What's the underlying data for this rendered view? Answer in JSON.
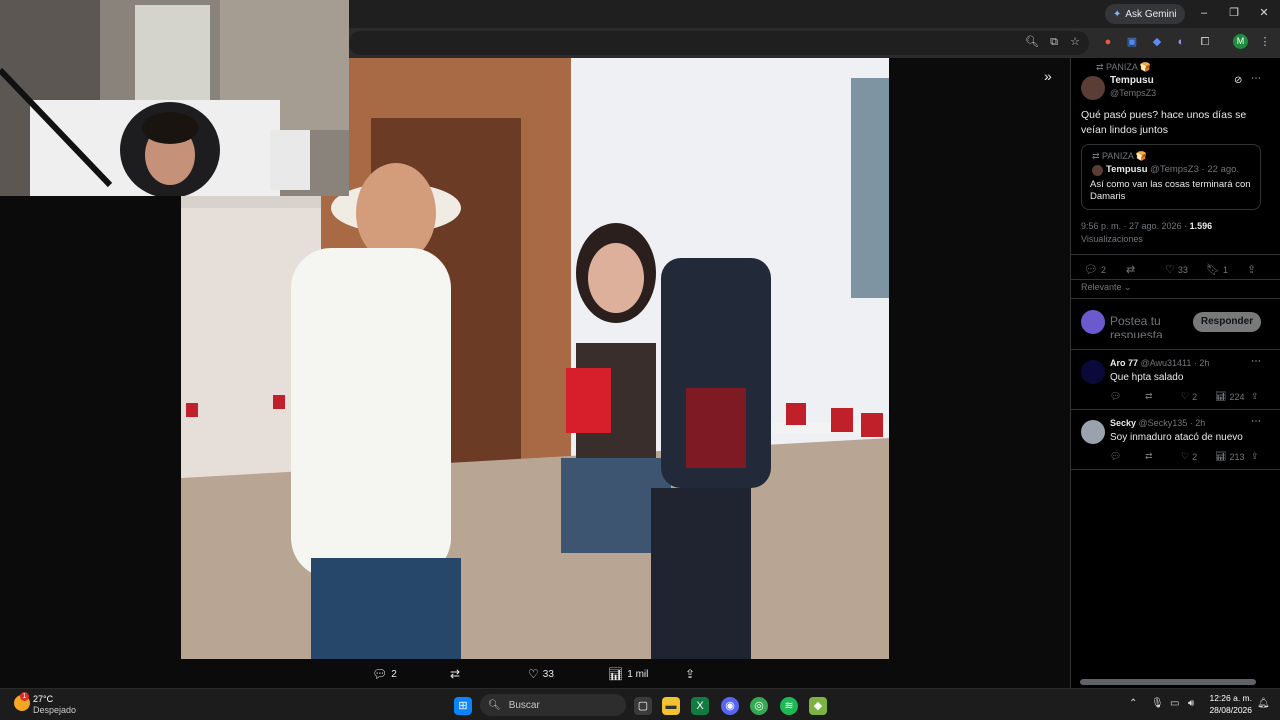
{
  "browser": {
    "gemini_label": "Ask Gemini",
    "profile_initial": "M"
  },
  "viewer": {
    "actions": {
      "replies": "2",
      "likes": "33",
      "views": "1 mil"
    }
  },
  "panel": {
    "repost_label": "PANIZA 🍞",
    "author_name": "Tempusu",
    "author_handle": "@TempsZ3",
    "post_text": "Qué pasó pues? hace unos días se veían lindos juntos",
    "quote": {
      "repost_label": "PANIZA 🍞",
      "author_name": "Tempusu",
      "meta": "@TempsZ3 · 22 ago.",
      "text": "Así como van las cosas terminará con Damaris"
    },
    "timestamp": "9:56 p. m. · 27 ago. 2026 ·",
    "views_count": "1.596",
    "views_label": "Visualizaciones",
    "stats": {
      "replies": "2",
      "likes": "33",
      "bookmarks": "1"
    },
    "sort_label": "Relevante",
    "reply_placeholder": "Postea tu respuesta",
    "reply_button": "Responder",
    "replies": [
      {
        "name": "Aro 77",
        "meta": "@Awu31411 · 2h",
        "text": "Que hpta salado",
        "likes": "2",
        "views": "224"
      },
      {
        "name": "Secky",
        "meta": "@Secky135 · 2h",
        "text": "Soy inmaduro atacó de nuevo",
        "likes": "2",
        "views": "213"
      }
    ]
  },
  "taskbar": {
    "weather_temp": "27°C",
    "weather_desc": "Despejado",
    "search_placeholder": "Buscar",
    "time": "12:26 a. m.",
    "date": "28/08/2026",
    "notification_count": "1"
  },
  "colors": {
    "accent": "#1d9bf0",
    "panel_bg": "#000000",
    "muted": "#71767b"
  }
}
